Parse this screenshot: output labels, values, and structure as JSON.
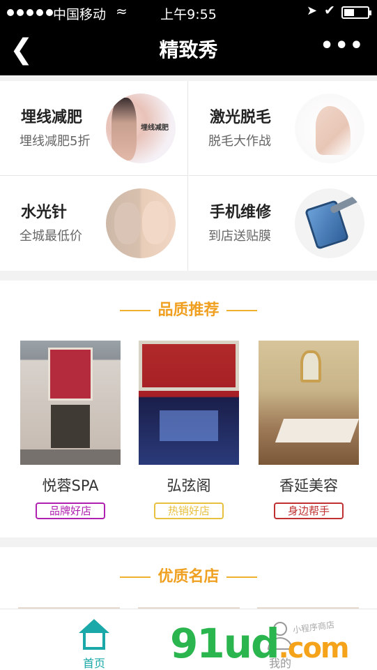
{
  "status_bar": {
    "carrier": "中国移动",
    "time": "上午9:55"
  },
  "nav": {
    "back_icon": "chevron-left-icon",
    "title": "精致秀",
    "more_icon": "more-dots-icon"
  },
  "services": [
    {
      "title": "埋线减肥",
      "subtitle": "埋线减肥5折",
      "image_text": "埋线减肥"
    },
    {
      "title": "激光脱毛",
      "subtitle": "脱毛大作战"
    },
    {
      "title": "水光针",
      "subtitle": "全城最低价"
    },
    {
      "title": "手机维修",
      "subtitle": "到店送贴膜"
    }
  ],
  "quality_section": {
    "title": "品质推荐",
    "shops": [
      {
        "name": "悦蓉SPA",
        "tag": "品牌好店",
        "tag_color": "#b020b0"
      },
      {
        "name": "弘弦阁",
        "tag": "热销好店",
        "tag_color": "#e8c040"
      },
      {
        "name": "香延美容",
        "tag": "身边帮手",
        "tag_color": "#c03030"
      }
    ]
  },
  "excellent_section": {
    "title": "优质名店"
  },
  "tabbar": {
    "items": [
      {
        "label": "首页",
        "icon": "home-icon",
        "color": "#1aa8a8"
      },
      {
        "label": "我的",
        "icon": "user-icon",
        "color": "#999999"
      }
    ]
  },
  "watermark": {
    "main": "91ud",
    "suffix": ".com",
    "sub": "小程序商店"
  }
}
